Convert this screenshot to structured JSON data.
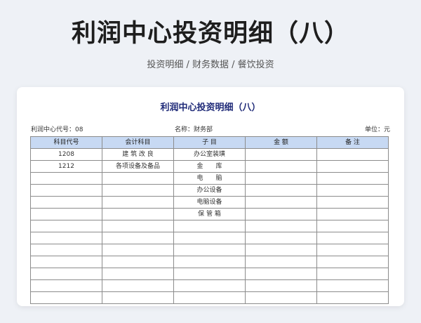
{
  "header": {
    "title": "利润中心投资明细（八）",
    "subtitle": "投资明细 / 财务数据 / 餐饮投资"
  },
  "sheet": {
    "title": "利润中心投资明细（八）",
    "center_code_label": "利润中心代号：08",
    "name_label": "名称：财务部",
    "unit_label": "单位：元",
    "columns": [
      "科目代号",
      "会计科目",
      "子 目",
      "金 额",
      "备 注"
    ],
    "rows": [
      [
        "1208",
        "建 筑 改 良",
        "办公室装璜",
        "",
        ""
      ],
      [
        "1212",
        "各项设备及备品",
        "金　　库",
        "",
        ""
      ],
      [
        "",
        "",
        "电　　脑",
        "",
        ""
      ],
      [
        "",
        "",
        "办公设备",
        "",
        ""
      ],
      [
        "",
        "",
        "电脑设备",
        "",
        ""
      ],
      [
        "",
        "",
        "保 管 箱",
        "",
        ""
      ],
      [
        "",
        "",
        "",
        "",
        ""
      ],
      [
        "",
        "",
        "",
        "",
        ""
      ],
      [
        "",
        "",
        "",
        "",
        ""
      ],
      [
        "",
        "",
        "",
        "",
        ""
      ],
      [
        "",
        "",
        "",
        "",
        ""
      ],
      [
        "",
        "",
        "",
        "",
        ""
      ],
      [
        "",
        "",
        "",
        "",
        ""
      ]
    ]
  }
}
